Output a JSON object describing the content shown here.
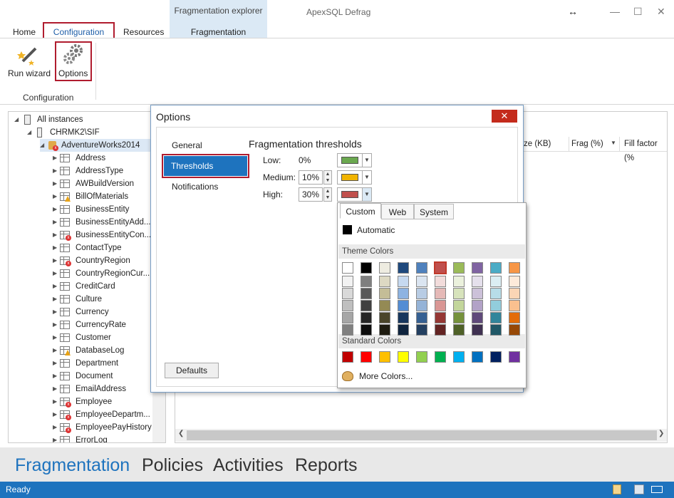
{
  "app": {
    "title": "ApexSQL Defrag",
    "ctx_group": "Fragmentation explorer",
    "resize_glyph": "↔",
    "min_glyph": "—",
    "max_glyph": "☐",
    "close_glyph": "✕"
  },
  "ribbon": {
    "tabs": [
      "Home",
      "Configuration",
      "Resources",
      "Fragmentation"
    ],
    "active_tab": "Configuration",
    "buttons": {
      "run_wizard": "Run wizard",
      "options": "Options"
    },
    "group_label": "Configuration"
  },
  "tree": {
    "root": "All instances",
    "server": "CHRMK2\\SIF",
    "database": "AdventureWorks2014",
    "tables": [
      {
        "name": "Address",
        "badge": ""
      },
      {
        "name": "AddressType",
        "badge": ""
      },
      {
        "name": "AWBuildVersion",
        "badge": ""
      },
      {
        "name": "BillOfMaterials",
        "badge": "warn"
      },
      {
        "name": "BusinessEntity",
        "badge": ""
      },
      {
        "name": "BusinessEntityAdd...",
        "badge": ""
      },
      {
        "name": "BusinessEntityCon...",
        "badge": "err"
      },
      {
        "name": "ContactType",
        "badge": ""
      },
      {
        "name": "CountryRegion",
        "badge": "err"
      },
      {
        "name": "CountryRegionCur...",
        "badge": ""
      },
      {
        "name": "CreditCard",
        "badge": ""
      },
      {
        "name": "Culture",
        "badge": ""
      },
      {
        "name": "Currency",
        "badge": ""
      },
      {
        "name": "CurrencyRate",
        "badge": ""
      },
      {
        "name": "Customer",
        "badge": ""
      },
      {
        "name": "DatabaseLog",
        "badge": "warn"
      },
      {
        "name": "Department",
        "badge": ""
      },
      {
        "name": "Document",
        "badge": ""
      },
      {
        "name": "EmailAddress",
        "badge": ""
      },
      {
        "name": "Employee",
        "badge": "err"
      },
      {
        "name": "EmployeeDepartm...",
        "badge": "err"
      },
      {
        "name": "EmployeePayHistory",
        "badge": "err"
      },
      {
        "name": "ErrorLog",
        "badge": ""
      }
    ]
  },
  "grid": {
    "columns": [
      "ze (KB)",
      "Frag (%)",
      "Fill factor (%"
    ]
  },
  "dialog": {
    "title": "Options",
    "close": "✕",
    "nav": [
      "General",
      "Thresholds",
      "Notifications"
    ],
    "selected": "Thresholds",
    "section_title": "Fragmentation thresholds",
    "rows": [
      {
        "label": "Low:",
        "value": "0%",
        "color": "#6aa84f"
      },
      {
        "label": "Medium:",
        "value": "10%",
        "color": "#f1b400"
      },
      {
        "label": "High:",
        "value": "30%",
        "color": "#c0504d"
      }
    ],
    "defaults": "Defaults"
  },
  "popup": {
    "tabs": [
      "Custom",
      "Web",
      "System"
    ],
    "active_tab": "Custom",
    "automatic": "Automatic",
    "theme_label": "Theme Colors",
    "standard_label": "Standard Colors",
    "more": "More Colors...",
    "theme_top": [
      "#ffffff",
      "#000000",
      "#eeece1",
      "#1f497d",
      "#4f81bd",
      "#c0504d",
      "#9bbb59",
      "#8064a2",
      "#4bacc6",
      "#f79646"
    ],
    "theme_shades": [
      [
        "#f2f2f2",
        "#d9d9d9",
        "#bfbfbf",
        "#a6a6a6",
        "#808080"
      ],
      [
        "#7f7f7f",
        "#595959",
        "#404040",
        "#262626",
        "#0d0d0d"
      ],
      [
        "#ddd9c3",
        "#c4bd97",
        "#948a54",
        "#4a452a",
        "#1e1c11"
      ],
      [
        "#c6d9f0",
        "#8db3e2",
        "#548dd4",
        "#17365d",
        "#0f243e"
      ],
      [
        "#dbe5f1",
        "#b8cce4",
        "#95b3d7",
        "#366092",
        "#244061"
      ],
      [
        "#f2dcdb",
        "#e5b9b7",
        "#d99694",
        "#953734",
        "#632423"
      ],
      [
        "#ebf1dd",
        "#d7e3bc",
        "#c3d69b",
        "#76923c",
        "#4f6128"
      ],
      [
        "#e5e0ec",
        "#ccc1d9",
        "#b2a2c7",
        "#5f497a",
        "#3f3151"
      ],
      [
        "#dbeef3",
        "#b7dde8",
        "#92cddc",
        "#31859b",
        "#205867"
      ],
      [
        "#fdeada",
        "#fbd5b5",
        "#fac08f",
        "#e36c09",
        "#974806"
      ]
    ],
    "standard": [
      "#c00000",
      "#ff0000",
      "#ffc000",
      "#ffff00",
      "#92d050",
      "#00b050",
      "#00b0f0",
      "#0070c0",
      "#002060",
      "#7030a0"
    ],
    "selected_color": "#c0504d"
  },
  "bottom_nav": [
    "Fragmentation",
    "Policies",
    "Activities",
    "Reports"
  ],
  "status": "Ready"
}
